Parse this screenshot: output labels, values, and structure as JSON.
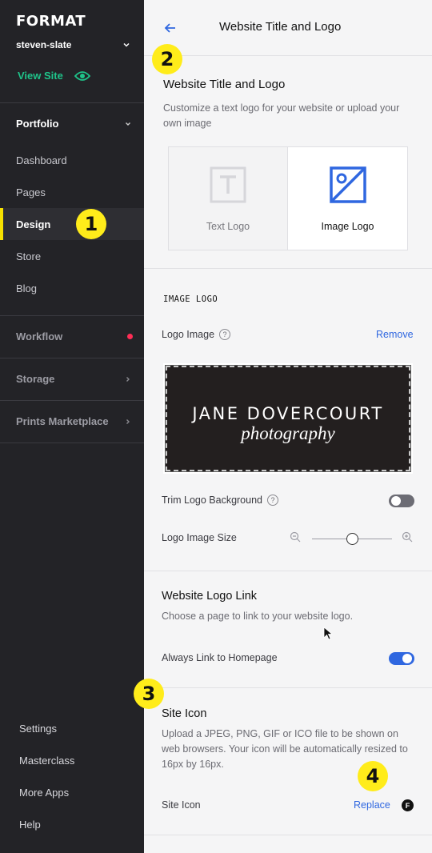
{
  "sidebar": {
    "brand": "FORMAT",
    "site_name": "steven-slate",
    "view_site": "View Site",
    "portfolio": "Portfolio",
    "nav": [
      "Dashboard",
      "Pages",
      "Design",
      "Store",
      "Blog"
    ],
    "active_nav": "Design",
    "workflow": "Workflow",
    "storage": "Storage",
    "prints": "Prints Marketplace",
    "bottom": [
      "Settings",
      "Masterclass",
      "More Apps",
      "Help"
    ]
  },
  "callouts": [
    "1",
    "2",
    "3",
    "4"
  ],
  "header": {
    "title": "Website Title and Logo"
  },
  "title_logo": {
    "heading": "Website Title and Logo",
    "description": "Customize a text logo for your website or upload your own image",
    "options": [
      "Text Logo",
      "Image Logo"
    ],
    "selected": "Image Logo"
  },
  "image_logo": {
    "section_label": "IMAGE LOGO",
    "logo_image_label": "Logo Image",
    "help_symbol": "?",
    "remove_label": "Remove",
    "preview_name": "JANE DOVERCOURT",
    "preview_sub": "photography",
    "trim_label": "Trim Logo Background",
    "trim_on": false,
    "size_label": "Logo Image Size",
    "size_level": 0.5
  },
  "logo_link": {
    "title": "Website Logo Link",
    "description": "Choose a page to link to your website logo.",
    "always_home_label": "Always Link to Homepage",
    "always_home_on": true
  },
  "site_icon": {
    "title": "Site Icon",
    "description": "Upload a JPEG, PNG, GIF or ICO file to be shown on web browsers. Your icon will be automatically resized to 16px by 16px.",
    "row_label": "Site Icon",
    "replace_label": "Replace",
    "icon_letter": "F"
  },
  "colors": {
    "sidebar_bg": "#232327",
    "accent_green": "#1fc48a",
    "link_blue": "#2f67e0",
    "callout_yellow": "#ffec1a",
    "notification_red": "#ff2d55"
  }
}
